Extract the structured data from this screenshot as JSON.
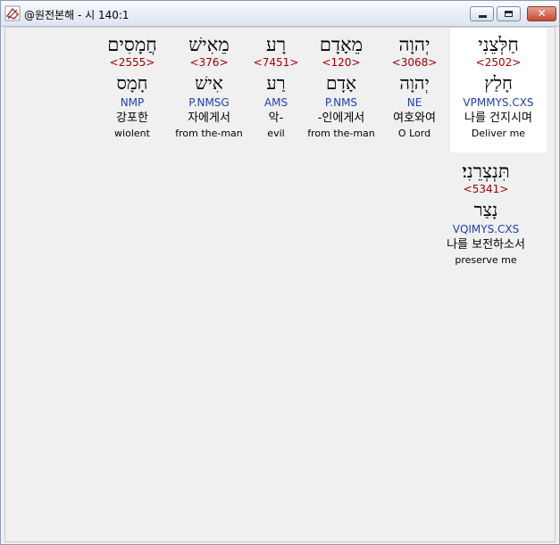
{
  "window": {
    "title": "@원전본해 - 시 140:1",
    "minimize_label": "",
    "maximize_label": "",
    "close_label": "✕"
  },
  "words": [
    {
      "hebrew": "חַלְּצֵנִי",
      "strong": "<2502>",
      "lemma": "חָלַץ",
      "parsing": "VPMMYS.CXS",
      "korean": "나를 건지시며",
      "english": "Deliver me"
    },
    {
      "hebrew": "יְהוָה",
      "strong": "<3068>",
      "lemma": "יְהוָה",
      "parsing": "NE",
      "korean": "여호와여",
      "english": "O Lord"
    },
    {
      "hebrew": "מֵאָדָם",
      "strong": "<120>",
      "lemma": "אָדָם",
      "parsing": "P.NMS",
      "korean": "-인에게서",
      "english": "from the-man"
    },
    {
      "hebrew": "רָע",
      "strong": "<7451>",
      "lemma": "רַע",
      "parsing": "AMS",
      "korean": "악-",
      "english": "evil"
    },
    {
      "hebrew": "מֵאִישׁ",
      "strong": "<376>",
      "lemma": "אִישׁ",
      "parsing": "P.NMSG",
      "korean": "자에게서",
      "english": "from the-man"
    },
    {
      "hebrew": "חֲמָסִים",
      "strong": "<2555>",
      "lemma": "חָמָס",
      "parsing": "NMP",
      "korean": "강포한",
      "english": "wiolent"
    },
    {
      "hebrew": "תִּנְצְרֵנִי׃",
      "strong": "<5341>",
      "lemma": "נָצַר",
      "parsing": "VQIMYS.CXS",
      "korean": "나를 보전하소서",
      "english": "preserve me"
    }
  ]
}
